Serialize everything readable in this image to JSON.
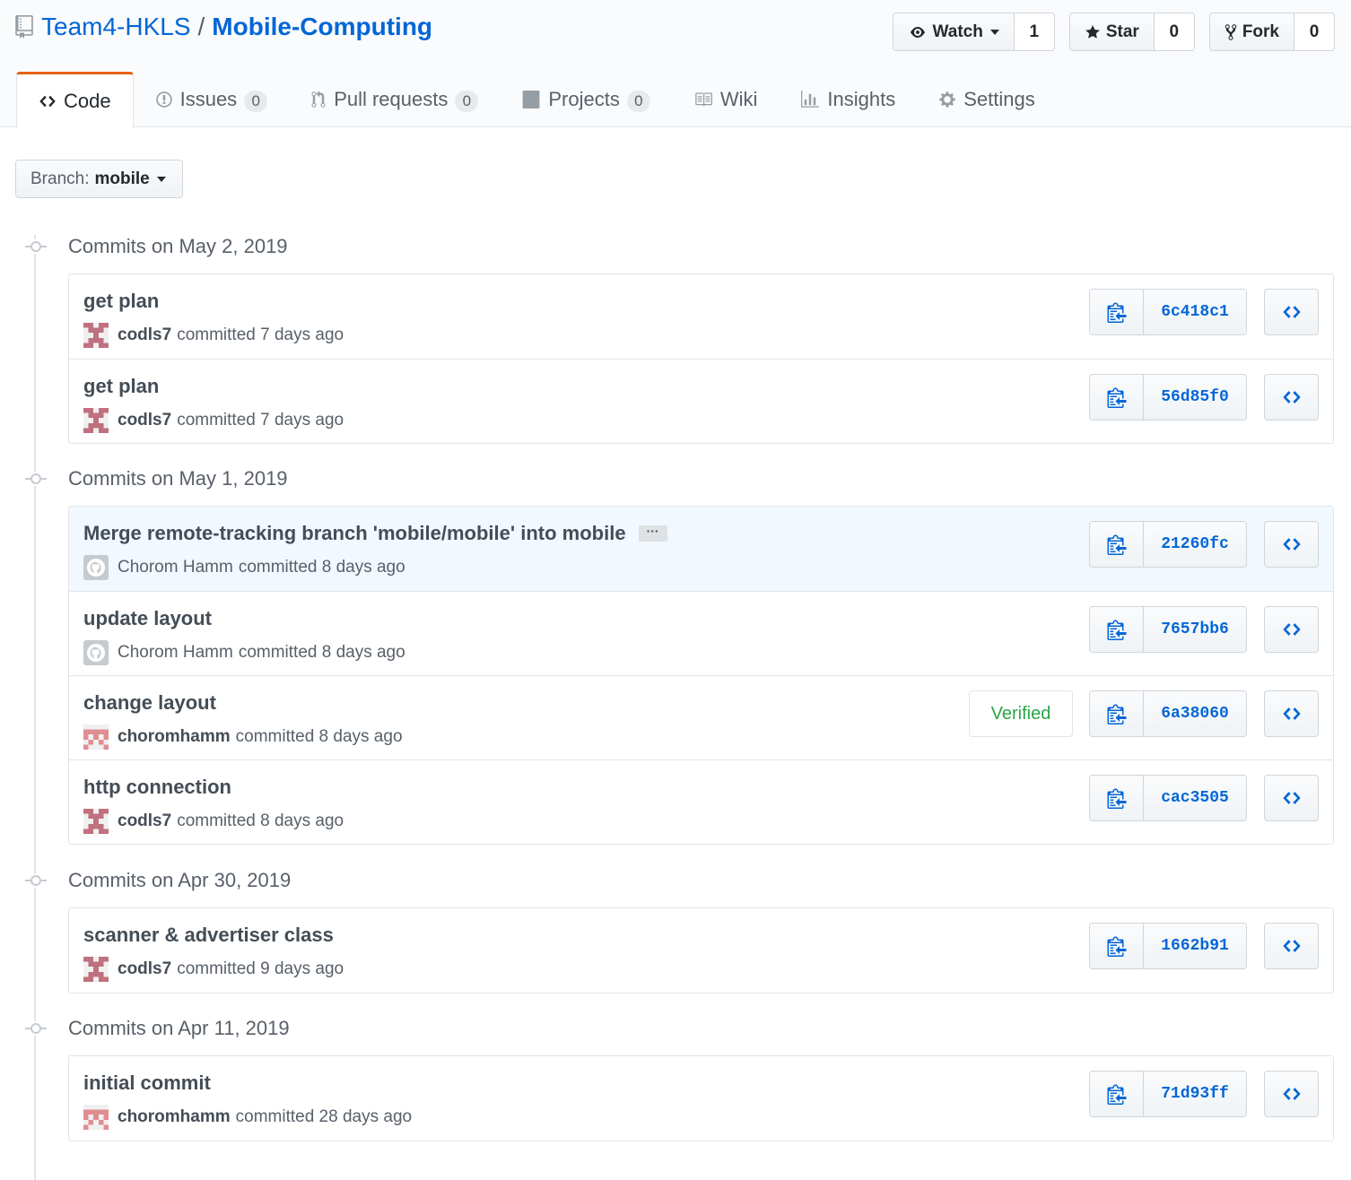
{
  "repo": {
    "owner": "Team4-HKLS",
    "separator": "/",
    "name": "Mobile-Computing"
  },
  "actions": {
    "watch": {
      "label": "Watch",
      "count": "1"
    },
    "star": {
      "label": "Star",
      "count": "0"
    },
    "fork": {
      "label": "Fork",
      "count": "0"
    }
  },
  "tabs": [
    {
      "label": "Code",
      "icon": "code-icon",
      "counter": null
    },
    {
      "label": "Issues",
      "icon": "issue-icon",
      "counter": "0"
    },
    {
      "label": "Pull requests",
      "icon": "pull-request-icon",
      "counter": "0"
    },
    {
      "label": "Projects",
      "icon": "project-icon",
      "counter": "0"
    },
    {
      "label": "Wiki",
      "icon": "book-icon",
      "counter": null
    },
    {
      "label": "Insights",
      "icon": "graph-icon",
      "counter": null
    },
    {
      "label": "Settings",
      "icon": "gear-icon",
      "counter": null
    }
  ],
  "branch": {
    "prefix": "Branch:",
    "name": "mobile"
  },
  "groups": [
    {
      "heading": "Commits on May 2, 2019",
      "commits": [
        {
          "message": "get plan",
          "author": "codls7",
          "action": "committed 7 days ago",
          "sha": "6c418c1",
          "avatar": "codls7"
        },
        {
          "message": "get plan",
          "author": "codls7",
          "action": "committed 7 days ago",
          "sha": "56d85f0",
          "avatar": "codls7"
        }
      ]
    },
    {
      "heading": "Commits on May 1, 2019",
      "commits": [
        {
          "message": "Merge remote-tracking branch 'mobile/mobile' into mobile",
          "author": "Chorom Hamm",
          "action": "committed 8 days ago",
          "sha": "21260fc",
          "avatar": "github",
          "ellipsis": "···",
          "highlight": true
        },
        {
          "message": "update layout",
          "author": "Chorom Hamm",
          "action": "committed 8 days ago",
          "sha": "7657bb6",
          "avatar": "github"
        },
        {
          "message": "change layout",
          "author": "choromhamm",
          "action": "committed 8 days ago",
          "sha": "6a38060",
          "avatar": "choromhamm",
          "verified": "Verified"
        },
        {
          "message": "http connection",
          "author": "codls7",
          "action": "committed 8 days ago",
          "sha": "cac3505",
          "avatar": "codls7"
        }
      ]
    },
    {
      "heading": "Commits on Apr 30, 2019",
      "commits": [
        {
          "message": "scanner & advertiser class",
          "author": "codls7",
          "action": "committed 9 days ago",
          "sha": "1662b91",
          "avatar": "codls7"
        }
      ]
    },
    {
      "heading": "Commits on Apr 11, 2019",
      "commits": [
        {
          "message": "initial commit",
          "author": "choromhamm",
          "action": "committed 28 days ago",
          "sha": "71d93ff",
          "avatar": "choromhamm"
        }
      ]
    }
  ],
  "colors": {
    "link": "#0366d6",
    "selected_tab_border": "#e36209",
    "verified": "#28a745",
    "highlight_row": "#f1f8ff"
  }
}
